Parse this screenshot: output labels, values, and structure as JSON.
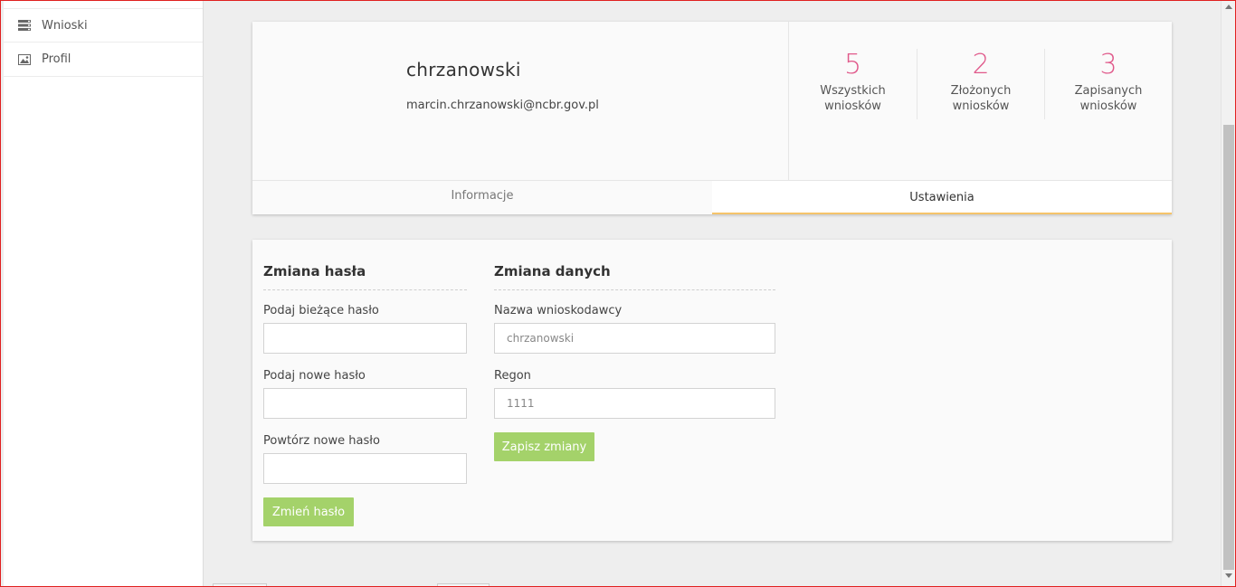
{
  "sidebar": {
    "items": [
      {
        "label": "Wnioski",
        "icon": "list-icon"
      },
      {
        "label": "Profil",
        "icon": "image-icon"
      }
    ]
  },
  "profile": {
    "name": "chrzanowski",
    "email": "marcin.chrzanowski@ncbr.gov.pl",
    "stats": [
      {
        "value": "5",
        "label_line1": "Wszystkich",
        "label_line2": "wniosków"
      },
      {
        "value": "2",
        "label_line1": "Złożonych",
        "label_line2": "wniosków"
      },
      {
        "value": "3",
        "label_line1": "Zapisanych",
        "label_line2": "wniosków"
      }
    ],
    "tabs": [
      {
        "label": "Informacje",
        "active": false
      },
      {
        "label": "Ustawienia",
        "active": true
      }
    ]
  },
  "password_change": {
    "title": "Zmiana hasła",
    "current_label": "Podaj bieżące hasło",
    "current_value": "",
    "new_label": "Podaj nowe hasło",
    "new_value": "",
    "repeat_label": "Powtórz nowe hasło",
    "repeat_value": "",
    "button_label": "Zmień hasło"
  },
  "data_change": {
    "title": "Zmiana danych",
    "name_label": "Nazwa wnioskodawcy",
    "name_value": "chrzanowski",
    "regon_label": "Regon",
    "regon_value": "1111",
    "button_label": "Zapisz zmiany"
  },
  "colors": {
    "accent_pink": "#e0588a",
    "button_green": "#a4d26a",
    "tab_underline": "#f5c46a",
    "frame_red": "#e0201f"
  }
}
